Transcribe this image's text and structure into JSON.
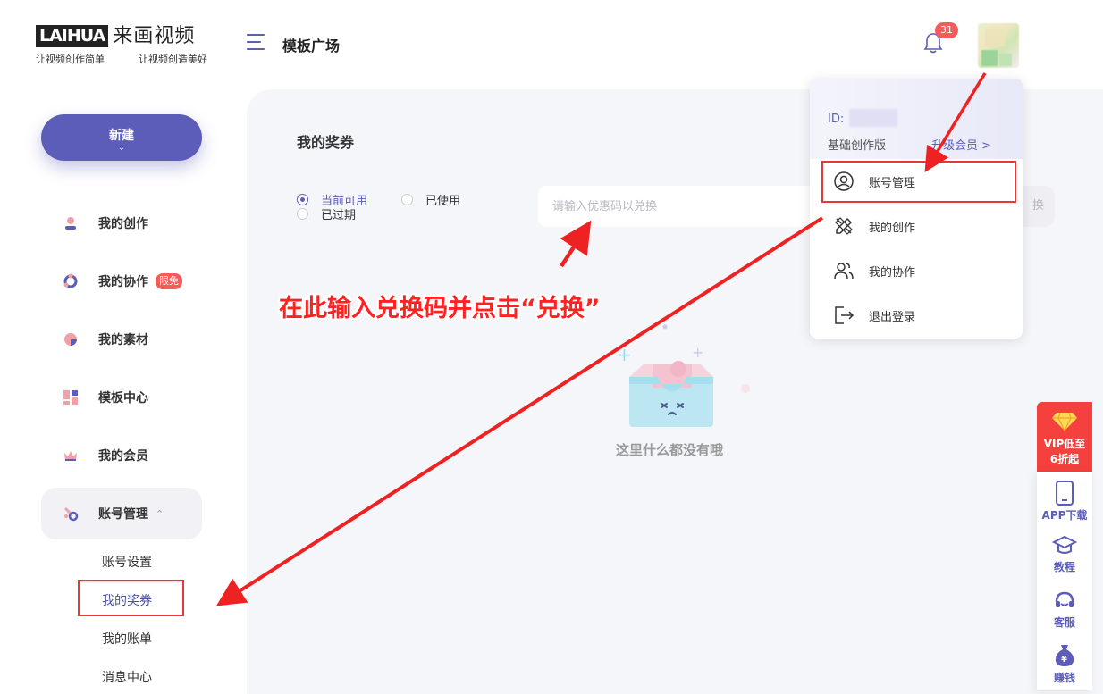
{
  "logo": {
    "brand_en": "LAIHUA",
    "brand_cn": "来画视频",
    "slogan_left": "让视频创作简单",
    "slogan_right": "让视频创造美好"
  },
  "header": {
    "title": "模板广场",
    "notification_count": "31"
  },
  "sidebar": {
    "new_button": "新建",
    "items": [
      {
        "label": "我的创作",
        "icon": "creation-icon"
      },
      {
        "label": "我的协作",
        "icon": "collab-icon",
        "badge": "限免"
      },
      {
        "label": "我的素材",
        "icon": "assets-icon"
      },
      {
        "label": "模板中心",
        "icon": "template-icon"
      },
      {
        "label": "我的会员",
        "icon": "crown-icon"
      },
      {
        "label": "账号管理",
        "icon": "account-icon"
      }
    ],
    "sub_items": [
      "账号设置",
      "我的奖券",
      "我的账单",
      "消息中心"
    ]
  },
  "main": {
    "title": "我的奖券",
    "filters": [
      {
        "label": "当前可用",
        "selected": true
      },
      {
        "label": "已使用",
        "selected": false
      },
      {
        "label": "已过期",
        "selected": false
      }
    ],
    "input_placeholder": "请输入优惠码以兑换",
    "redeem_button": "换",
    "empty_text": "这里什么都没有哦"
  },
  "annotation": {
    "text": "在此输入兑换码并点击“兑换”",
    "color": "#ee2222"
  },
  "dropdown": {
    "user_name": "",
    "id_label": "ID:",
    "version": "基础创作版",
    "upgrade": "升级会员 >",
    "menu": [
      {
        "label": "账号管理",
        "icon": "user-circle-icon"
      },
      {
        "label": "我的创作",
        "icon": "pencil-ruler-icon"
      },
      {
        "label": "我的协作",
        "icon": "users-icon"
      },
      {
        "label": "退出登录",
        "icon": "logout-icon"
      }
    ]
  },
  "float_bar": {
    "vip_line1": "VIP低至",
    "vip_line2": "6折起",
    "items": [
      {
        "label": "APP下载",
        "icon": "phone-icon"
      },
      {
        "label": "教程",
        "icon": "graduation-cap-icon"
      },
      {
        "label": "客服",
        "icon": "headset-icon"
      },
      {
        "label": "赚钱",
        "icon": "money-bag-icon"
      }
    ]
  },
  "colors": {
    "primary": "#5b5db8",
    "annotation_red": "#ee2222",
    "vip_red": "#f5413d",
    "badge_red": "#f45b5b"
  }
}
